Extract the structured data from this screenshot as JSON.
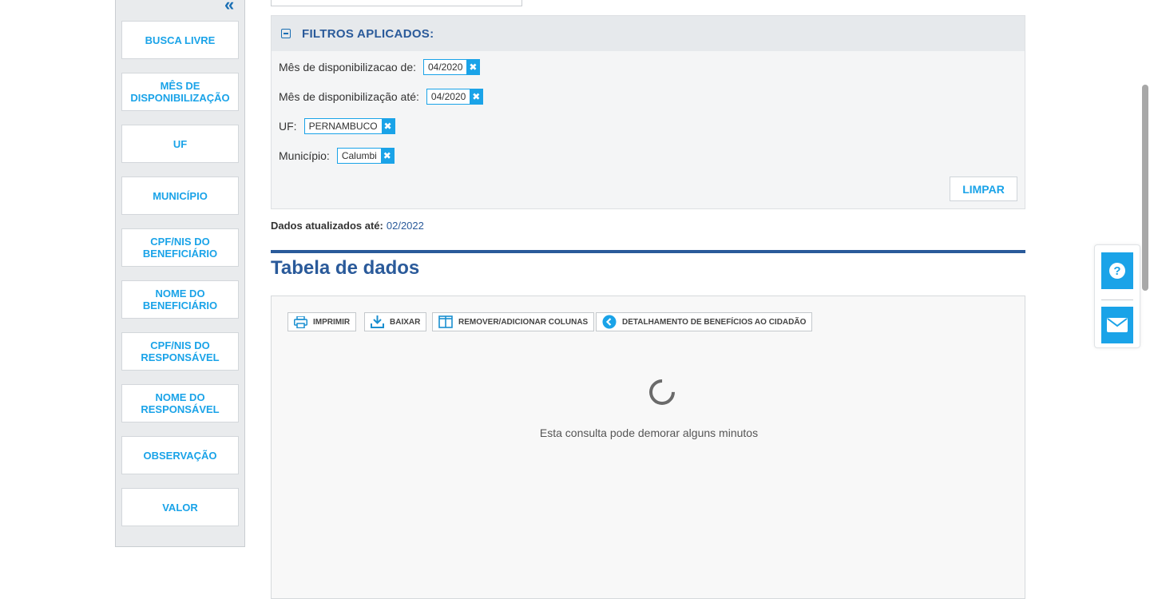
{
  "sidebar": {
    "collapse_glyph": "«",
    "items": [
      {
        "label": "BUSCA LIVRE"
      },
      {
        "label": "MÊS DE DISPONIBILIZAÇÃO"
      },
      {
        "label": "UF"
      },
      {
        "label": "MUNICÍPIO"
      },
      {
        "label": "CPF/NIS DO BENEFICIÁRIO"
      },
      {
        "label": "NOME DO BENEFICIÁRIO"
      },
      {
        "label": "CPF/NIS DO RESPONSÁVEL"
      },
      {
        "label": "NOME DO RESPONSÁVEL"
      },
      {
        "label": "OBSERVAÇÃO"
      },
      {
        "label": "VALOR"
      }
    ]
  },
  "filters": {
    "title": "FILTROS APLICADOS:",
    "rows": [
      {
        "label": "Mês de disponibilizacao de:",
        "value": "04/2020"
      },
      {
        "label": "Mês de disponibilização até:",
        "value": "04/2020"
      },
      {
        "label": "UF:",
        "value": "PERNAMBUCO"
      },
      {
        "label": "Município:",
        "value": "Calumbi"
      }
    ],
    "remove_glyph": "✖",
    "clear_label": "LIMPAR"
  },
  "updated": {
    "label": "Dados atualizados até:",
    "value": "02/2022"
  },
  "table": {
    "title": "Tabela de dados",
    "toolbar": {
      "print_label": "IMPRIMIR",
      "download_label": "BAIXAR",
      "columns_label": "REMOVER/ADICIONAR COLUNAS",
      "details_label": "DETALHAMENTO DE BENEFÍCIOS AO CIDADÃO"
    },
    "loading_text": "Esta consulta pode demorar alguns minutos"
  },
  "floating": {
    "help_icon": "help-icon",
    "mail_icon": "mail-icon"
  },
  "colors": {
    "accent": "#1aa3e8",
    "heading": "#2a5a9a"
  }
}
